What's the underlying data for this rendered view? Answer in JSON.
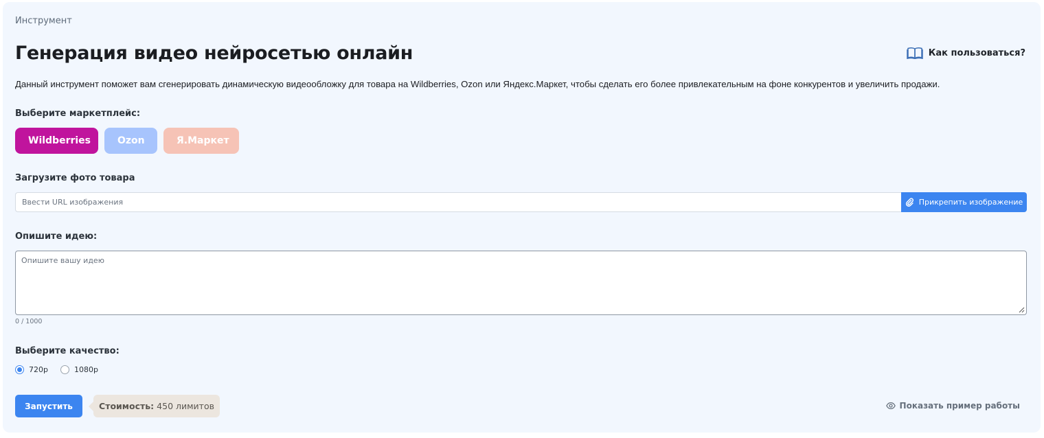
{
  "breadcrumb": "Инструмент",
  "title": "Генерация видео нейросетью онлайн",
  "howto": {
    "label": "Как пользоваться?",
    "icon": "book-open-icon"
  },
  "description": "Данный инструмент поможет вам сгенерировать динамическую видеообложку для товара на Wildberries, Ozon или Яндекс.Маркет, чтобы сделать его более привлекательным на фоне конкурентов и увеличить продажи.",
  "marketplace": {
    "label": "Выберите маркетплейс:",
    "options": [
      {
        "label": "Wildberries",
        "color": "#c0149d",
        "selected": true
      },
      {
        "label": "Ozon",
        "color": "#a7c4fd",
        "selected": false
      },
      {
        "label": "Я.Маркет",
        "color": "#f6c3b6",
        "selected": false
      }
    ]
  },
  "upload": {
    "label": "Загрузите фото товара",
    "placeholder": "Ввести URL изображения",
    "value": "",
    "attach_label": "Прикрепить изображение",
    "attach_icon": "paperclip-icon"
  },
  "idea": {
    "label": "Опишите идею:",
    "placeholder": "Опишите вашу идею",
    "value": "",
    "counter": "0 / 1000"
  },
  "quality": {
    "label": "Выберите качество:",
    "options": [
      {
        "label": "720p",
        "selected": true
      },
      {
        "label": "1080p",
        "selected": false
      }
    ]
  },
  "run": {
    "label": "Запустить"
  },
  "cost": {
    "label": "Стоимость:",
    "value": "450 лимитов"
  },
  "example": {
    "label": "Показать пример работы",
    "icon": "eye-icon"
  },
  "colors": {
    "accent": "#3c85f0",
    "background": "#f2f7fe"
  }
}
